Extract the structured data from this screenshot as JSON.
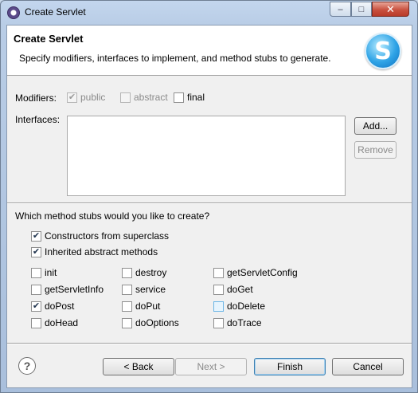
{
  "window": {
    "title": "Create Servlet",
    "minimize": "‒",
    "maximize": "□",
    "close": "✕"
  },
  "header": {
    "title": "Create Servlet",
    "description": "Specify modifiers, interfaces to implement, and method stubs to generate.",
    "logo_letter": "S"
  },
  "modifiers": {
    "label": "Modifiers:",
    "public": {
      "label": "public",
      "checked": true,
      "enabled": false
    },
    "abstract": {
      "label": "abstract",
      "checked": false,
      "enabled": false
    },
    "final": {
      "label": "final",
      "checked": false,
      "enabled": true
    }
  },
  "interfaces": {
    "label": "Interfaces:",
    "add_label": "Add...",
    "remove_label": "Remove"
  },
  "stubs": {
    "question": "Which method stubs would you like to create?",
    "constructors": {
      "label": "Constructors from superclass",
      "checked": true
    },
    "inherited": {
      "label": "Inherited abstract methods",
      "checked": true
    },
    "methods": [
      {
        "label": "init",
        "checked": false
      },
      {
        "label": "destroy",
        "checked": false
      },
      {
        "label": "getServletConfig",
        "checked": false
      },
      {
        "label": "getServletInfo",
        "checked": false
      },
      {
        "label": "service",
        "checked": false
      },
      {
        "label": "doGet",
        "checked": false
      },
      {
        "label": "doPost",
        "checked": true
      },
      {
        "label": "doPut",
        "checked": false
      },
      {
        "label": "doDelete",
        "checked": false
      },
      {
        "label": "doHead",
        "checked": false
      },
      {
        "label": "doOptions",
        "checked": false
      },
      {
        "label": "doTrace",
        "checked": false
      }
    ]
  },
  "footer": {
    "help": "?",
    "back_label": "< Back",
    "next_label": "Next >",
    "finish_label": "Finish",
    "cancel_label": "Cancel"
  },
  "check_mark": "✔"
}
